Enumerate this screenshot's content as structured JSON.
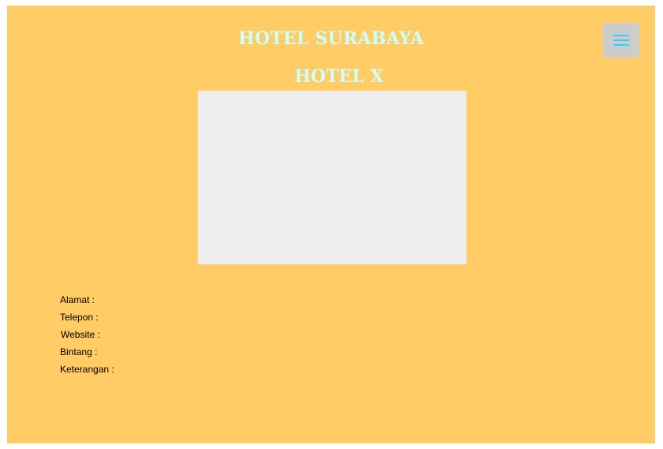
{
  "header": {
    "site_title": "HOTEL SURABAYA",
    "hotel_name": "HOTEL X"
  },
  "menu": {
    "icon": "hamburger-menu-icon"
  },
  "details": [
    {
      "label": "Alamat :"
    },
    {
      "label": "Telepon :"
    },
    {
      "label": "Website :"
    },
    {
      "label": "Bintang :"
    },
    {
      "label": "Keterangan :"
    }
  ],
  "colors": {
    "background": "#ffcc66",
    "title": "#ccffff",
    "menu_button": "#cccccc",
    "menu_icon": "#33ccff",
    "image_placeholder": "#eeeeee"
  }
}
